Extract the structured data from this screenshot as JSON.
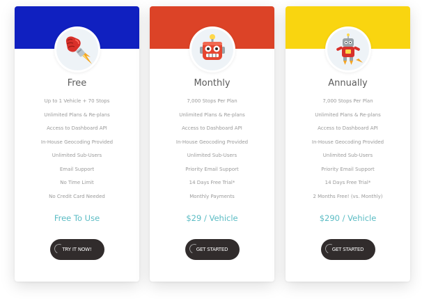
{
  "colors": {
    "free_band": "#1020c0",
    "monthly_band": "#dc4327",
    "annual_band": "#f9d510",
    "price_text": "#5bbcc4",
    "button_bg": "#312c2c"
  },
  "plans": [
    {
      "name": "Free",
      "icon": "rocket-glove-icon",
      "features": [
        "Up to 1 Vehicle + 70 Stops",
        "Unlimited Plans & Re-plans",
        "Access to Dashboard API",
        "In-House Geocoding Provided",
        "Unlimited Sub-Users",
        "Email Support",
        "No Time Limit",
        "No Credit Card Needed"
      ],
      "price": "Free To Use",
      "cta": "TRY IT NOW!"
    },
    {
      "name": "Monthly",
      "icon": "robot-head-icon",
      "features": [
        "7,000 Stops Per Plan",
        "Unlimited Plans & Re-plans",
        "Access to Dashboard API",
        "In-House Geocoding Provided",
        "Unlimited Sub-Users",
        "Priority Email Support",
        "14 Days Free Trial*",
        "Monthly Payments"
      ],
      "price": "$29 / Vehicle",
      "cta": "GET STARTED"
    },
    {
      "name": "Annually",
      "icon": "flying-robot-icon",
      "features": [
        "7,000 Stops Per Plan",
        "Unlimited Plans & Re-plans",
        "Access to Dashboard API",
        "In-House Geocoding Provided",
        "Unlimited Sub-Users",
        "Priority Email Support",
        "14 Days Free Trial*",
        "2 Months Free! (vs. Monthly)"
      ],
      "price": "$290 / Vehicle",
      "cta": "GET STARTED"
    }
  ]
}
